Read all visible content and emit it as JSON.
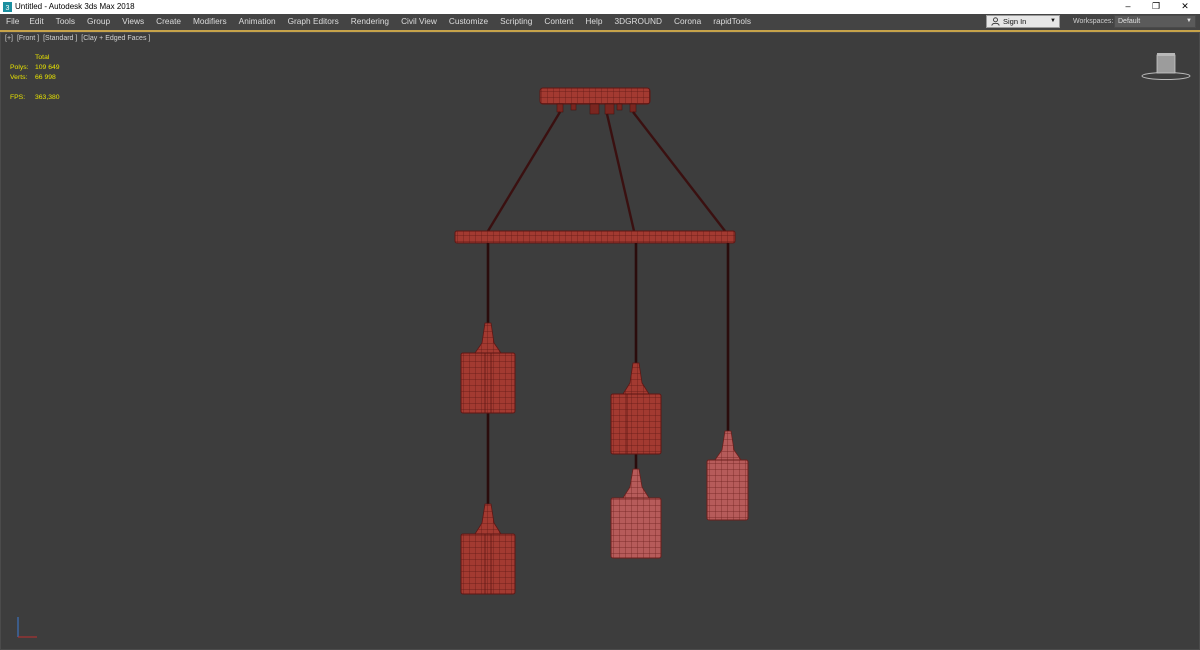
{
  "window": {
    "title": "Untitled - Autodesk 3ds Max 2018",
    "minimize_glyph": "–",
    "restore_glyph": "❐",
    "close_glyph": "✕"
  },
  "menu": {
    "items": [
      "File",
      "Edit",
      "Tools",
      "Group",
      "Views",
      "Create",
      "Modifiers",
      "Animation",
      "Graph Editors",
      "Rendering",
      "Civil View",
      "Customize",
      "Scripting",
      "Content",
      "Help",
      "3DGROUND",
      "Corona",
      "rapidTools"
    ],
    "sign_in": "Sign In",
    "workspaces_label": "Workspaces:",
    "workspaces_value": "Default",
    "dropdown_glyph": "▼"
  },
  "viewport": {
    "label_parts": [
      "[+]",
      "[Front ]",
      "[Standard ]",
      "[Clay + Edged Faces ]"
    ],
    "stats": {
      "header": "Total",
      "polys_label": "Polys:",
      "polys_value": "109 649",
      "verts_label": "Verts:",
      "verts_value": "66 998",
      "fps_label": "FPS:",
      "fps_value": "363,380"
    }
  },
  "colors": {
    "model_fill": "#a33a31",
    "model_fill_light": "#b65b5a",
    "wire": "#5e1714",
    "cable": "#3a1010",
    "stats_text": "#e9e400",
    "viewport_bg": "#3d3d3d"
  },
  "icons": {
    "app": "3dsmax-logo-icon",
    "user": "user-icon",
    "viewcube": "viewcube-icon",
    "axis": "axis-tripod-icon"
  }
}
